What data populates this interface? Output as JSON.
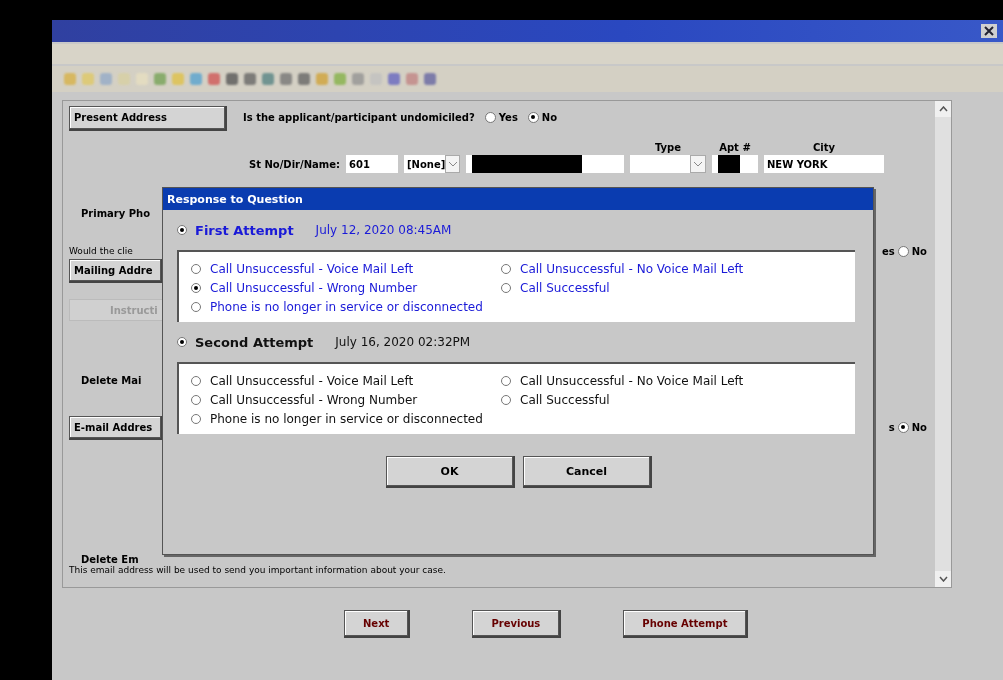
{
  "form": {
    "present_address_button": "Present Address",
    "undomiciled_question": "Is the applicant/participant undomiciled?",
    "undomiciled_options": [
      {
        "label": "Yes",
        "selected": false
      },
      {
        "label": "No",
        "selected": true
      }
    ],
    "address_headers": [
      "Type",
      "Apt #",
      "City"
    ],
    "street_label": "St No/Dir/Name:",
    "street_number": "601",
    "direction": "[None]",
    "city": "NEW YORK",
    "primary_phone_label": "Primary Pho",
    "client_question": "Would the clie",
    "client_answer": {
      "cut_label": "es",
      "no_label": "No",
      "no_selected": false
    },
    "mailing_address_button": "Mailing Addre",
    "instructions_button": "Instructi",
    "delete_mailing_label": "Delete Mai",
    "email_address_button": "E-mail Addres",
    "email_answer": {
      "cut_label": "s",
      "no_label": "No",
      "no_selected": true
    },
    "delete_email_label": "Delete Em",
    "email_notice": "This email address will be used to send you important information about your case."
  },
  "dialog": {
    "title": "Response to Question",
    "attempts": [
      {
        "label": "First Attempt",
        "date": "July 12, 2020 08:45AM",
        "selected": true,
        "highlighted": true,
        "options": [
          {
            "label": "Call Unsuccessful - Voice Mail Left",
            "selected": false
          },
          {
            "label": "Call Unsuccessful - No Voice Mail Left",
            "selected": false
          },
          {
            "label": "Call Unsuccessful - Wrong Number",
            "selected": true
          },
          {
            "label": "Call Successful",
            "selected": false
          },
          {
            "label": "Phone is no longer in service or disconnected",
            "selected": false
          }
        ]
      },
      {
        "label": "Second Attempt",
        "date": "July 16, 2020 02:32PM",
        "selected": true,
        "highlighted": false,
        "options": [
          {
            "label": "Call Unsuccessful - Voice Mail Left",
            "selected": false
          },
          {
            "label": "Call Unsuccessful - No Voice Mail Left",
            "selected": false
          },
          {
            "label": "Call Unsuccessful - Wrong Number",
            "selected": false
          },
          {
            "label": "Call Successful",
            "selected": false
          },
          {
            "label": "Phone is no longer in service or disconnected",
            "selected": false
          }
        ]
      }
    ],
    "buttons": [
      "OK",
      "Cancel"
    ]
  },
  "footer_buttons": [
    "Next",
    "Previous",
    "Phone Attempt"
  ]
}
